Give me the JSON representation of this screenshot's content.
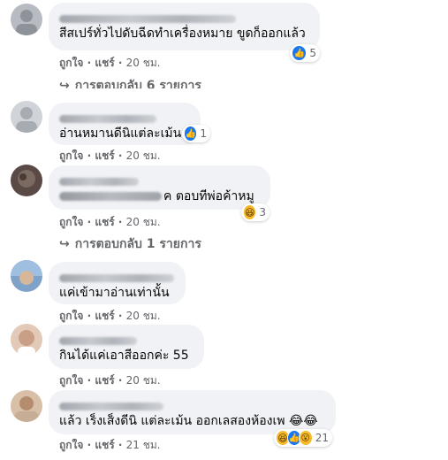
{
  "comments": [
    {
      "text": "สีสเปร์ทั่วไปดับฉีดทำเครื่องหมาย ขูดก็ออกแล้ว",
      "like_label": "ถูกใจ",
      "reply_label": "แชร์",
      "time": "20 ชม.",
      "reaction_count": "5",
      "reaction_icons": [
        "like-icon"
      ],
      "replies_label": "การตอบกลับ 6 รายการ"
    },
    {
      "text": "อ่านหมานดีนิแต่ละเม้น",
      "like_label": "ถูกใจ",
      "reply_label": "แชร์",
      "time": "20 ชม.",
      "reaction_count": "1",
      "reaction_icons": [
        "like-icon"
      ]
    },
    {
      "text_suffix": "ค ตอบทีพ่อค้าหมู",
      "like_label": "ถูกใจ",
      "reply_label": "แชร์",
      "time": "20 ชม.",
      "reaction_count": "3",
      "reaction_icons": [
        "haha-icon"
      ],
      "replies_label": "การตอบกลับ 1 รายการ"
    },
    {
      "text": "แค่เข้ามาอ่านเท่านั้น",
      "like_label": "ถูกใจ",
      "reply_label": "แชร์",
      "time": "20 ชม."
    },
    {
      "text": "กินได้แค่เอาสีออกค่ะ 55",
      "like_label": "ถูกใจ",
      "reply_label": "แชร์",
      "time": "20 ชม."
    },
    {
      "text": "แล้ว เร็งเส็งดีนิ แต่ละเม้น ออกเลสองห้องเพ 😂😂",
      "like_label": "ถูกใจ",
      "reply_label": "แชร์",
      "time": "21 ชม.",
      "reaction_count": "21",
      "reaction_icons": [
        "haha-icon",
        "like-icon",
        "wow-icon"
      ]
    }
  ],
  "separator": "·",
  "colors": {
    "bubble": "#f0f2f5",
    "meta": "#65676b",
    "like_blue": "#1877f2",
    "haha_yellow": "#f7b928"
  }
}
